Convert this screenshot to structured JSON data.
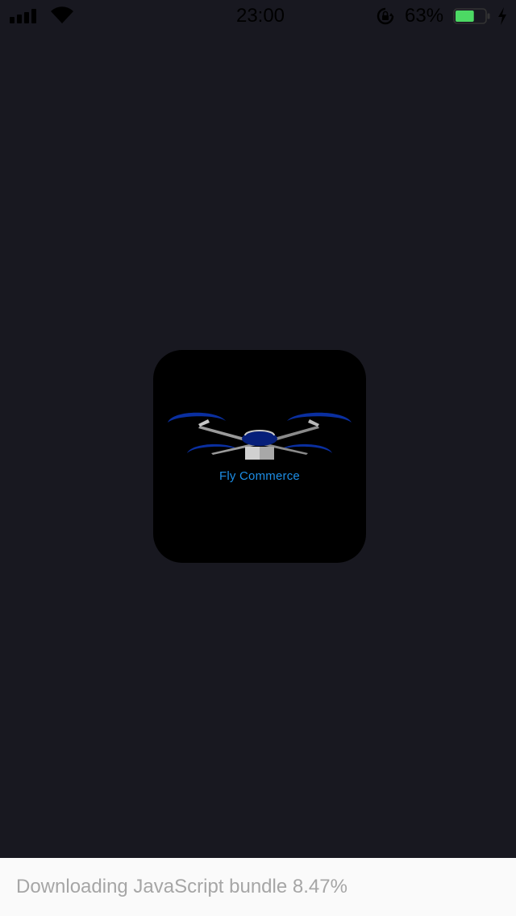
{
  "status_bar": {
    "time": "23:00",
    "battery_percent": "63%",
    "battery_level": 0.63,
    "icons": [
      "signal-icon",
      "wifi-icon",
      "orientation-lock-icon",
      "battery-icon",
      "charging-bolt-icon"
    ]
  },
  "splash": {
    "logo_text": "Fly Commerce",
    "logo_icon": "drone-icon",
    "colors": {
      "background": "#181820",
      "logo_tile": "#000000",
      "logo_text": "#1d8ee6",
      "propeller": "#0a2fa0"
    }
  },
  "download": {
    "message": "Downloading JavaScript bundle 8.47%",
    "progress_percent": 8.47
  }
}
